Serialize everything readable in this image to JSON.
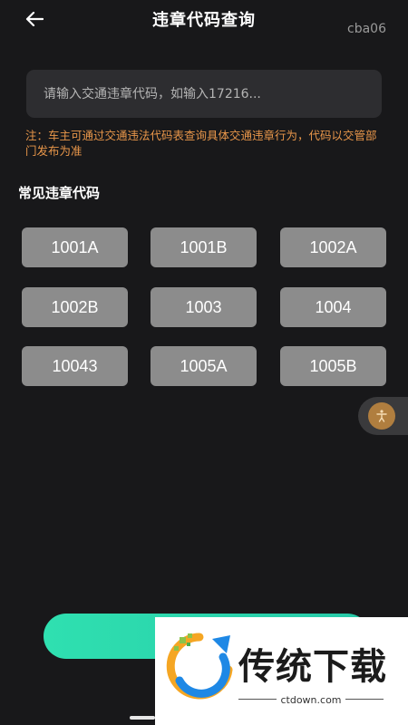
{
  "header": {
    "title": "违章代码查询",
    "tag": "cba06",
    "back_icon": "arrow-left-icon"
  },
  "search": {
    "placeholder": "请输入交通违章代码，如输入17216...",
    "value": ""
  },
  "note": "注：车主可通过交通违法代码表查询具体交通违章行为，代码以交管部门发布为准",
  "section_title": "常见违章代码",
  "codes": [
    "1001A",
    "1001B",
    "1002A",
    "1002B",
    "1003",
    "1004",
    "10043",
    "1005A",
    "1005B"
  ],
  "colors": {
    "background": "#18181a",
    "input_bg": "#2d2d30",
    "note": "#e8964a",
    "code_button": "#8c8c8c",
    "query_button": "#2fe0b0"
  },
  "watermark": {
    "title": "传统下载",
    "url": "ctdown.com"
  }
}
